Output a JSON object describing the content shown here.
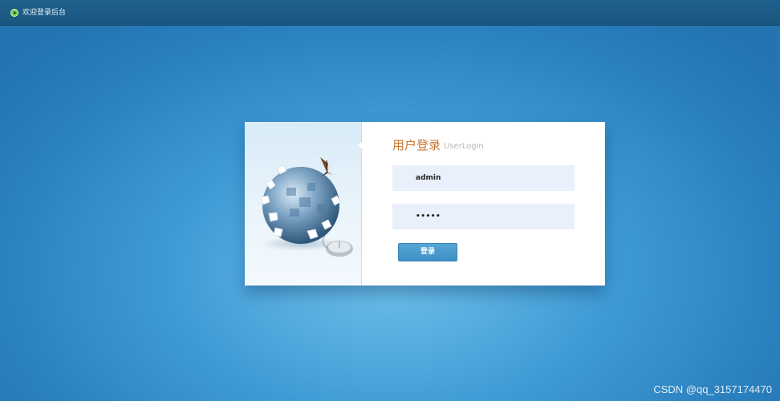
{
  "header": {
    "icon": "play-circle-icon",
    "title": "欢迎登录后台"
  },
  "login": {
    "title": "用户登录",
    "subtitle": "UserLogin",
    "username_value": "admin",
    "password_value": "•••••",
    "submit_label": "登录"
  },
  "illustration": {
    "icons": [
      "globe-puzzle-icon",
      "butterfly-icon",
      "mouse-icon"
    ]
  },
  "colors": {
    "topbar": "#1d5b86",
    "title_accent": "#c8762f",
    "button": "#4a9ccf",
    "field_bg": "#e9f0fb"
  },
  "watermark": "CSDN @qq_3157174470"
}
